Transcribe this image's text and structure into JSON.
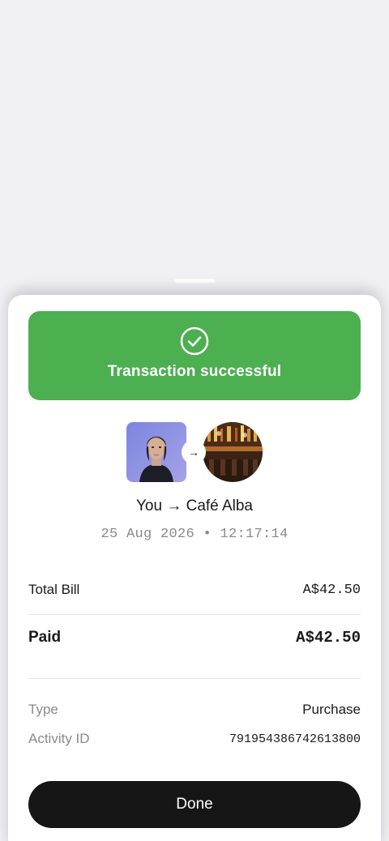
{
  "banner": {
    "title": "Transaction successful",
    "icon": "check-circle-icon",
    "color": "#4caf50"
  },
  "transfer": {
    "sender_label": "You",
    "arrow": "→",
    "recipient": "Café Alba",
    "parties_text": "You → Café Alba",
    "timestamp": "25 Aug 2026 • 12:17:14",
    "sender_avatar": "user-photo",
    "recipient_avatar": "merchant-photo"
  },
  "summary": {
    "total_label": "Total Bill",
    "total_value": "A$42.50",
    "paid_label": "Paid",
    "paid_value": "A$42.50"
  },
  "details": {
    "type_label": "Type",
    "type_value": "Purchase",
    "activity_label": "Activity ID",
    "activity_value": "791954386742613800"
  },
  "actions": {
    "done_label": "Done"
  }
}
